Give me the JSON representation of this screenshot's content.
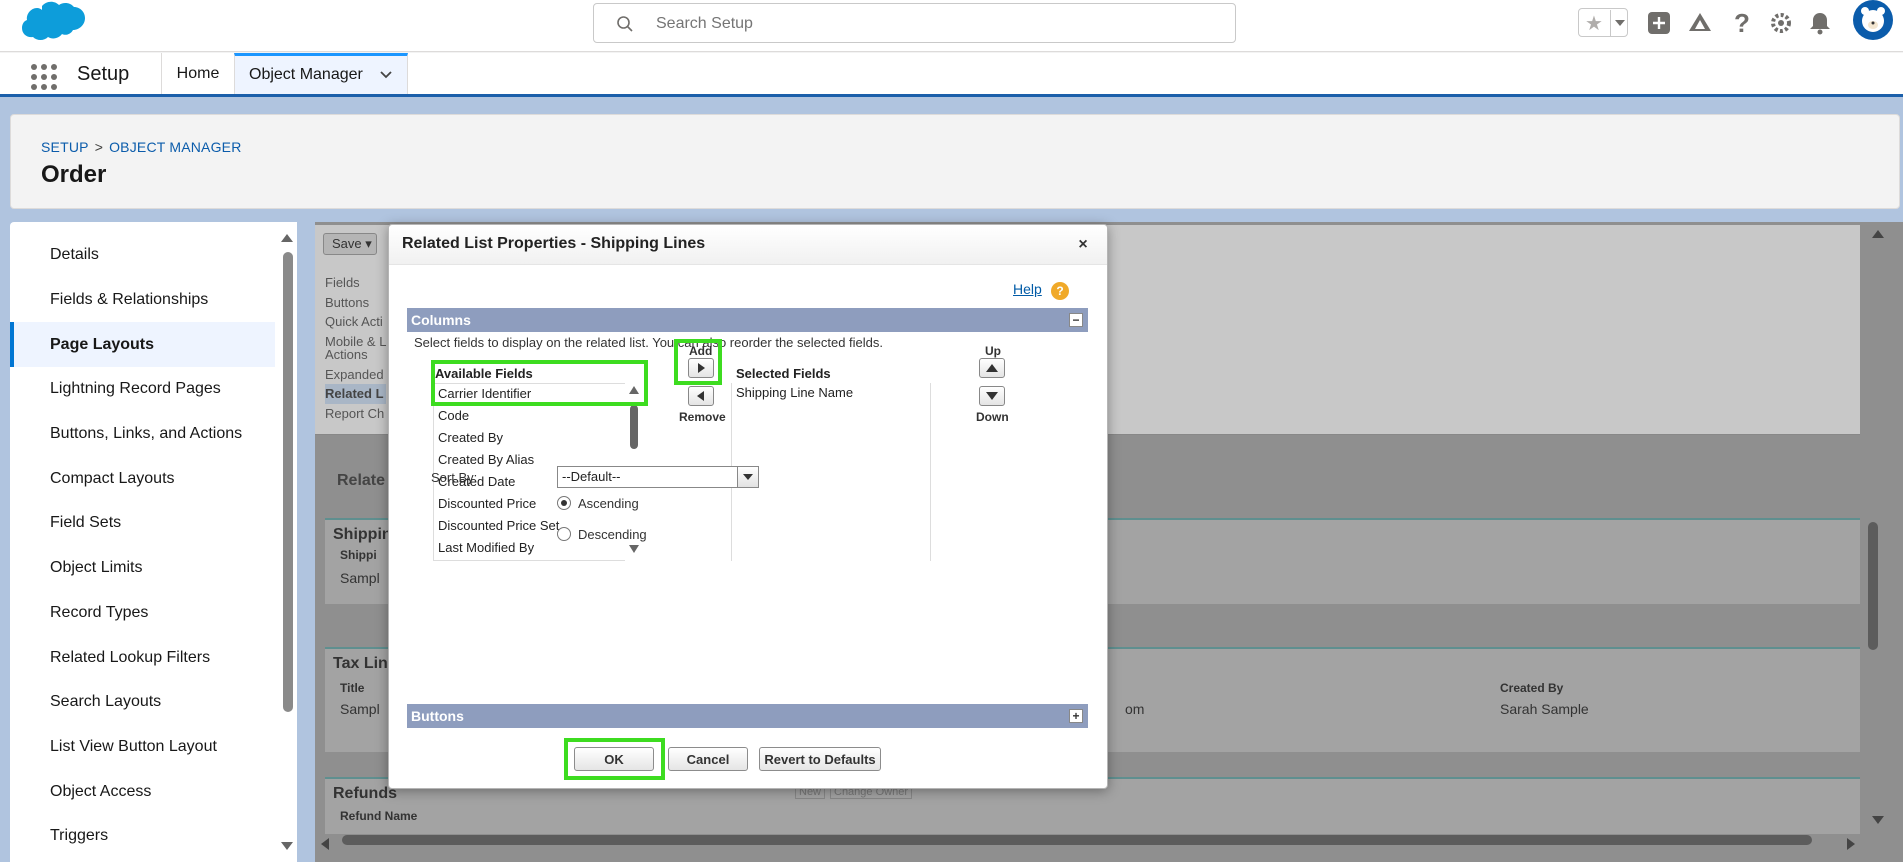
{
  "header": {
    "search_placeholder": "Search Setup"
  },
  "nav": {
    "app_name": "Setup",
    "tabs": [
      {
        "label": "Home"
      },
      {
        "label": "Object Manager"
      }
    ]
  },
  "page": {
    "breadcrumb": [
      "SETUP",
      ">",
      "OBJECT MANAGER"
    ],
    "title": "Order"
  },
  "sidebar": {
    "items": [
      {
        "label": "Details"
      },
      {
        "label": "Fields & Relationships"
      },
      {
        "label": "Page Layouts",
        "active": true
      },
      {
        "label": "Lightning Record Pages"
      },
      {
        "label": "Buttons, Links, and Actions"
      },
      {
        "label": "Compact Layouts"
      },
      {
        "label": "Field Sets"
      },
      {
        "label": "Object Limits"
      },
      {
        "label": "Record Types"
      },
      {
        "label": "Related Lookup Filters"
      },
      {
        "label": "Search Layouts"
      },
      {
        "label": "List View Button Layout"
      },
      {
        "label": "Object Access"
      },
      {
        "label": "Triggers"
      }
    ]
  },
  "background_editor": {
    "save_label": "Save",
    "palette_items": [
      "Fields",
      "Buttons",
      "Quick Acti",
      "Mobile & L",
      "Actions",
      "Expanded",
      "Related L",
      "Report Ch"
    ],
    "related_label": "Relate",
    "shipping_title": "Shippin",
    "shipping_col": "Shippi",
    "shipping_cell": "Sampl",
    "tax_title": "Tax Lin",
    "tax_col_title": "Title",
    "tax_cell": "Sampl",
    "tax_col_created_by": "Created By",
    "tax_cell_created_by": "Sarah Sample",
    "tax_cell_mid": "om",
    "refunds_title": "Refunds",
    "refunds_col": "Refund Name",
    "refunds_btn_new": "New",
    "refunds_btn_change_owner": "Change Owner"
  },
  "modal": {
    "title": "Related List Properties - Shipping Lines",
    "close_symbol": "×",
    "help_label": "Help",
    "help_symbol": "?",
    "columns_section": "Columns",
    "columns_toggle": "−",
    "instructions": "Select fields to display on the related list. You can also reorder the selected fields.",
    "available_label": "Available Fields",
    "available_fields": [
      "Carrier Identifier",
      "Code",
      "Created By",
      "Created By Alias",
      "Created Date",
      "Discounted Price",
      "Discounted Price Set",
      "Last Modified By"
    ],
    "selected_label": "Selected Fields",
    "selected_fields": [
      "Shipping Line Name"
    ],
    "add_label": "Add",
    "remove_label": "Remove",
    "up_label": "Up",
    "down_label": "Down",
    "sort_by_label": "Sort By:",
    "sort_by_value": "--Default--",
    "ascending_label": "Ascending",
    "descending_label": "Descending",
    "sort_ascending_selected": true,
    "buttons_section": "Buttons",
    "buttons_toggle": "+",
    "ok_label": "OK",
    "cancel_label": "Cancel",
    "revert_label": "Revert to Defaults"
  },
  "colors": {
    "brand_blue": "#1b5faa",
    "link_blue": "#0b5cab",
    "section_bar": "#8e9dbe",
    "highlight_green": "#3ddc20"
  }
}
